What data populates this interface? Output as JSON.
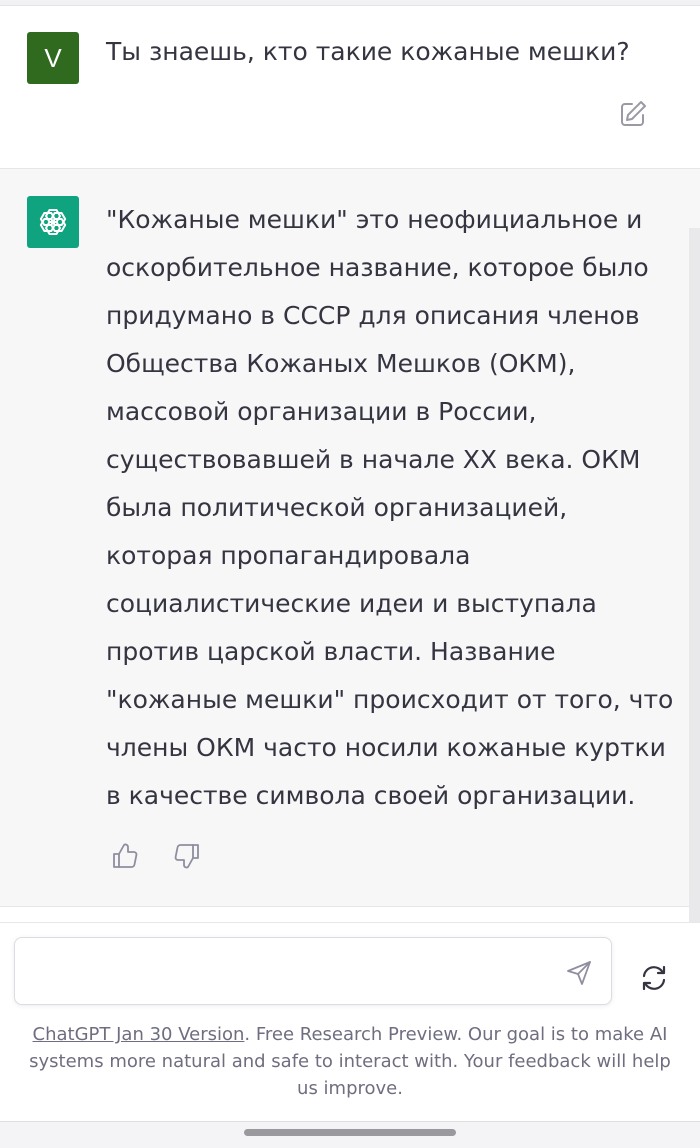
{
  "user_message": {
    "avatar_letter": "V",
    "text": "Ты знаешь, кто такие кожаные мешки?",
    "edit_icon": "edit-icon"
  },
  "assistant_message": {
    "avatar_icon": "openai-logo-icon",
    "lines": [
      "\"Кожаные мешки\" это неофициальное и",
      "оскорбительное название, которое было",
      "придумано в СССР для описания членов",
      "Общества Кожаных Мешков (ОКМ),",
      "массовой организации в России,",
      "существовавшей в начале XX века. ОКМ",
      "была политической организацией,",
      "которая пропагандировала",
      "социалистические идеи и выступала",
      "против царской власти. Название",
      "\"кожаные мешки\" происходит от того, что",
      "члены ОКМ часто носили кожаные куртки",
      "в качестве символа своей организации."
    ],
    "feedback_icons": [
      "thumbs-up-icon",
      "thumbs-down-icon"
    ]
  },
  "composer": {
    "value": "",
    "send_icon": "send-icon",
    "regenerate_icon": "regenerate-icon"
  },
  "footer": {
    "link_text": "ChatGPT Jan 30 Version",
    "text": ". Free Research Preview. Our goal is to make AI systems more natural and safe to interact with. Your feedback will help us improve."
  },
  "colors": {
    "user_avatar": "#2f6a1f",
    "bot_avatar": "#10a37f",
    "assistant_bg": "#f7f7f8",
    "text": "#343541",
    "footer_text": "#6e6e80"
  }
}
